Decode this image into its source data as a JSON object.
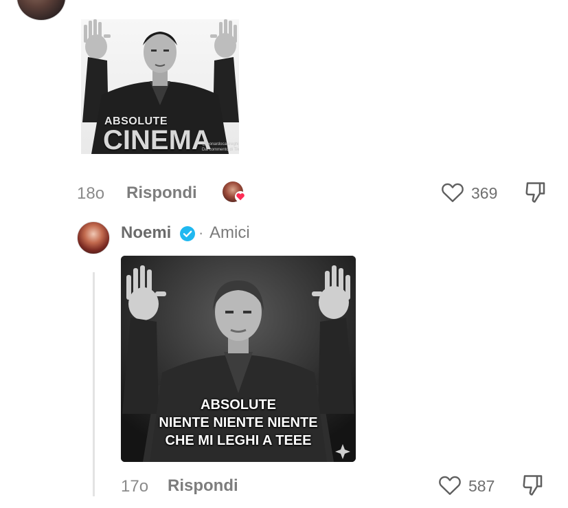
{
  "comment1": {
    "meme": {
      "line1": "ABSOLUTE",
      "line2": "CINEMA",
      "watermark": "@leonardocasireghi_\nDal commento di TikTok"
    },
    "age": "18o",
    "reply_label": "Rispondi",
    "likes": "369"
  },
  "comment2": {
    "author": "Noemi",
    "separator": "·",
    "relation": "Amici",
    "meme": {
      "line1": "ABSOLUTE",
      "line2": "NIENTE NIENTE NIENTE",
      "line3": "CHE MI LEGHI A TEEE"
    },
    "age": "17o",
    "reply_label": "Rispondi",
    "likes": "587"
  },
  "colors": {
    "verified": "#20b8f0",
    "heart_badge": "#fe2c55"
  },
  "icons": [
    "heart-outline-icon",
    "thumbs-down-icon",
    "verified-badge-icon",
    "sparkle-icon"
  ]
}
